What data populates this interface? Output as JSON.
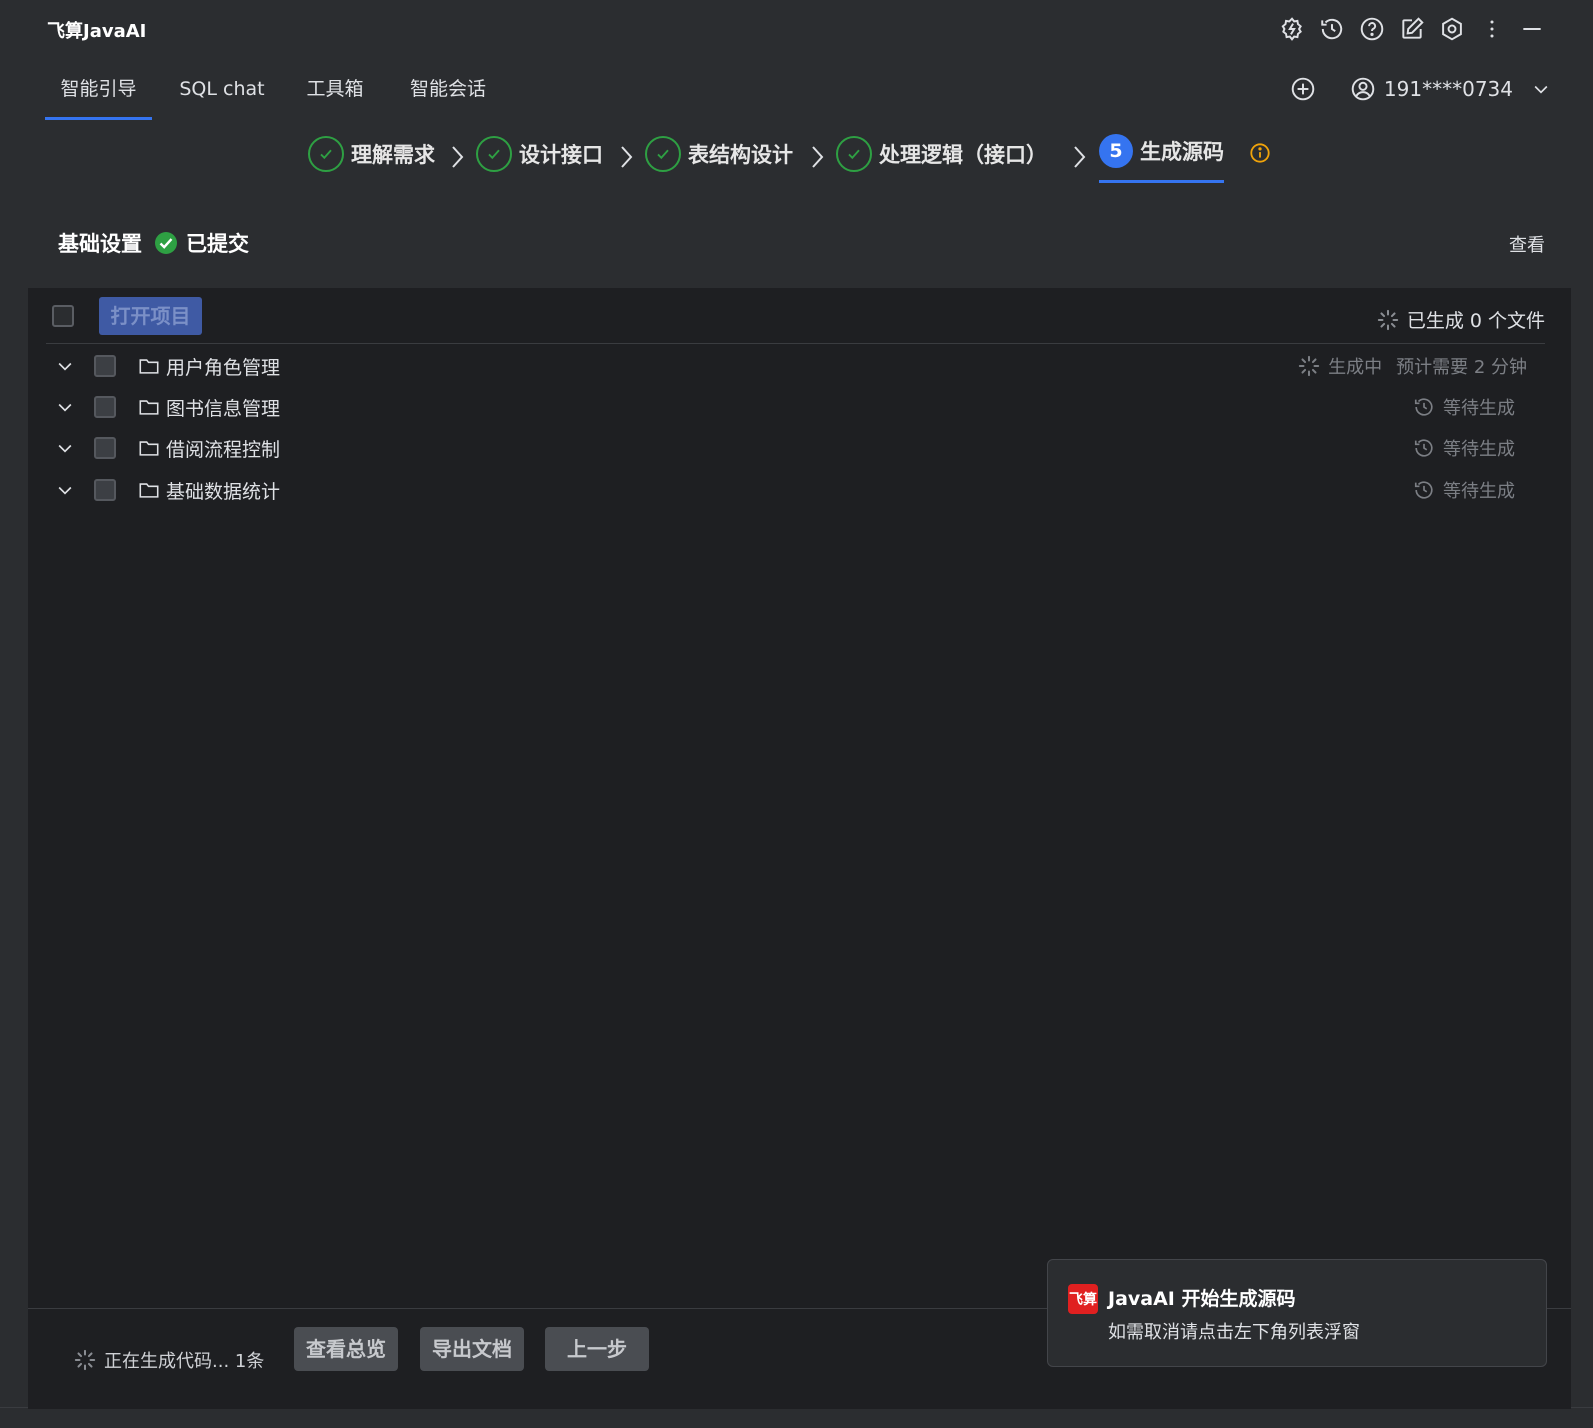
{
  "app": {
    "title": "飞算JavaAI"
  },
  "title_icons": [
    "plugin-icon",
    "history-icon",
    "help-icon",
    "edit-icon",
    "settings-icon",
    "more-icon",
    "minimize-icon"
  ],
  "tabs": [
    {
      "label": "智能引导",
      "active": true
    },
    {
      "label": "SQL chat",
      "active": false
    },
    {
      "label": "工具箱",
      "active": false
    },
    {
      "label": "智能会话",
      "active": false
    }
  ],
  "user": {
    "phone": "191****0734"
  },
  "steps": [
    {
      "label": "理解需求",
      "done": true
    },
    {
      "label": "设计接口",
      "done": true
    },
    {
      "label": "表结构设计",
      "done": true
    },
    {
      "label": "处理逻辑（接口）",
      "done": true
    },
    {
      "label": "生成源码",
      "number": "5",
      "active": true
    }
  ],
  "basic": {
    "title": "基础设置",
    "status": "已提交",
    "view": "查看"
  },
  "list": {
    "open_button": "打开项目",
    "gen_count": "已生成 0 个文件",
    "modules": [
      {
        "name": "用户角色管理",
        "status": "生成中",
        "eta": "预计需要 2 分钟"
      },
      {
        "name": "图书信息管理",
        "status": "等待生成"
      },
      {
        "name": "借阅流程控制",
        "status": "等待生成"
      },
      {
        "name": "基础数据统计",
        "status": "等待生成"
      }
    ]
  },
  "footer": {
    "status": "正在生成代码... 1条",
    "buttons": [
      "查看总览",
      "导出文档",
      "上一步"
    ]
  },
  "toast": {
    "logo": "飞算",
    "title": "JavaAI 开始生成源码",
    "message": "如需取消请点击左下角列表浮窗"
  },
  "colors": {
    "accent": "#3574f0",
    "success": "#2ea043",
    "warning": "#f0a30a",
    "toast_logo": "#e02020"
  }
}
